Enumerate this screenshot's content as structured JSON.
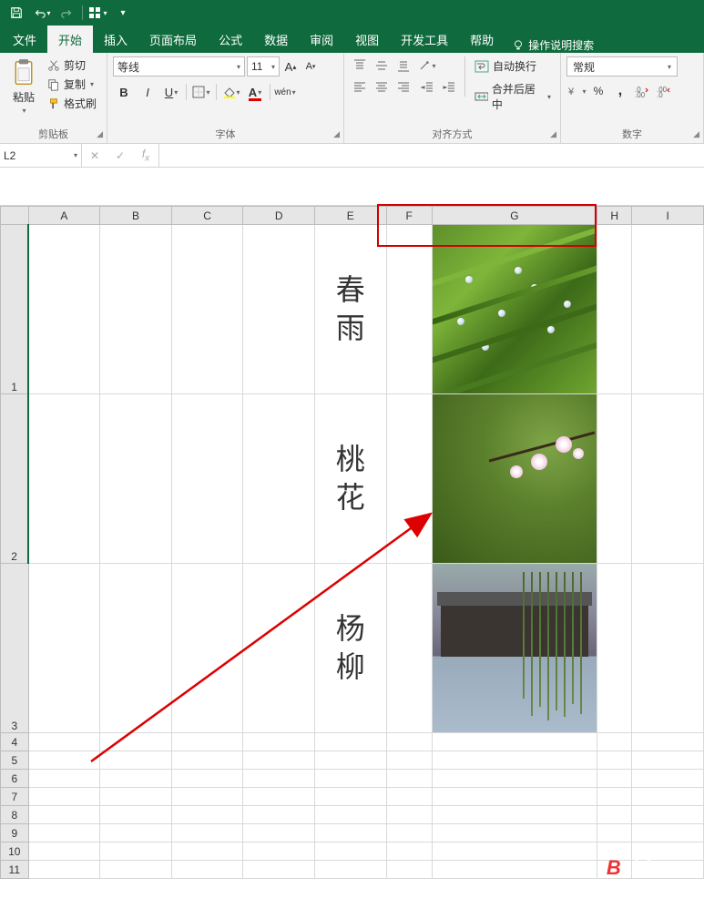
{
  "qat": {
    "save": "保存",
    "undo": "撤销",
    "redo": "重做",
    "touch": "触摸/鼠标模式"
  },
  "tabs": {
    "file": "文件",
    "home": "开始",
    "insert": "插入",
    "layout": "页面布局",
    "formulas": "公式",
    "data": "数据",
    "review": "审阅",
    "view": "视图",
    "developer": "开发工具",
    "help": "帮助",
    "tellme": "操作说明搜索"
  },
  "ribbon": {
    "clipboard": {
      "paste": "粘贴",
      "cut": "剪切",
      "copy": "复制",
      "format_painter": "格式刷",
      "label": "剪贴板"
    },
    "font": {
      "name": "等线",
      "size": "11",
      "bold": "B",
      "italic": "I",
      "underline": "U",
      "phonetic": "wén",
      "label": "字体"
    },
    "alignment": {
      "wrap": "自动换行",
      "merge": "合并后居中",
      "label": "对齐方式"
    },
    "number": {
      "format": "常规",
      "percent": "%",
      "comma": ",",
      "label": "数字"
    }
  },
  "namebox": "L2",
  "formula": "",
  "columns": [
    "A",
    "B",
    "C",
    "D",
    "E",
    "F",
    "G",
    "H",
    "I"
  ],
  "rows_tall": [
    "1",
    "2",
    "3"
  ],
  "rows_short": [
    "4",
    "5",
    "6",
    "7",
    "8",
    "9",
    "10",
    "11"
  ],
  "cells": {
    "e1_a": "春",
    "e1_b": "雨",
    "e2_a": "桃",
    "e2_b": "花",
    "e3_a": "杨",
    "e3_b": "柳"
  },
  "watermark": {
    "brand_initial": "B",
    "brand_rest": "aidu",
    "brand_cn": "经验",
    "url": "jingyan.baidu.com"
  }
}
